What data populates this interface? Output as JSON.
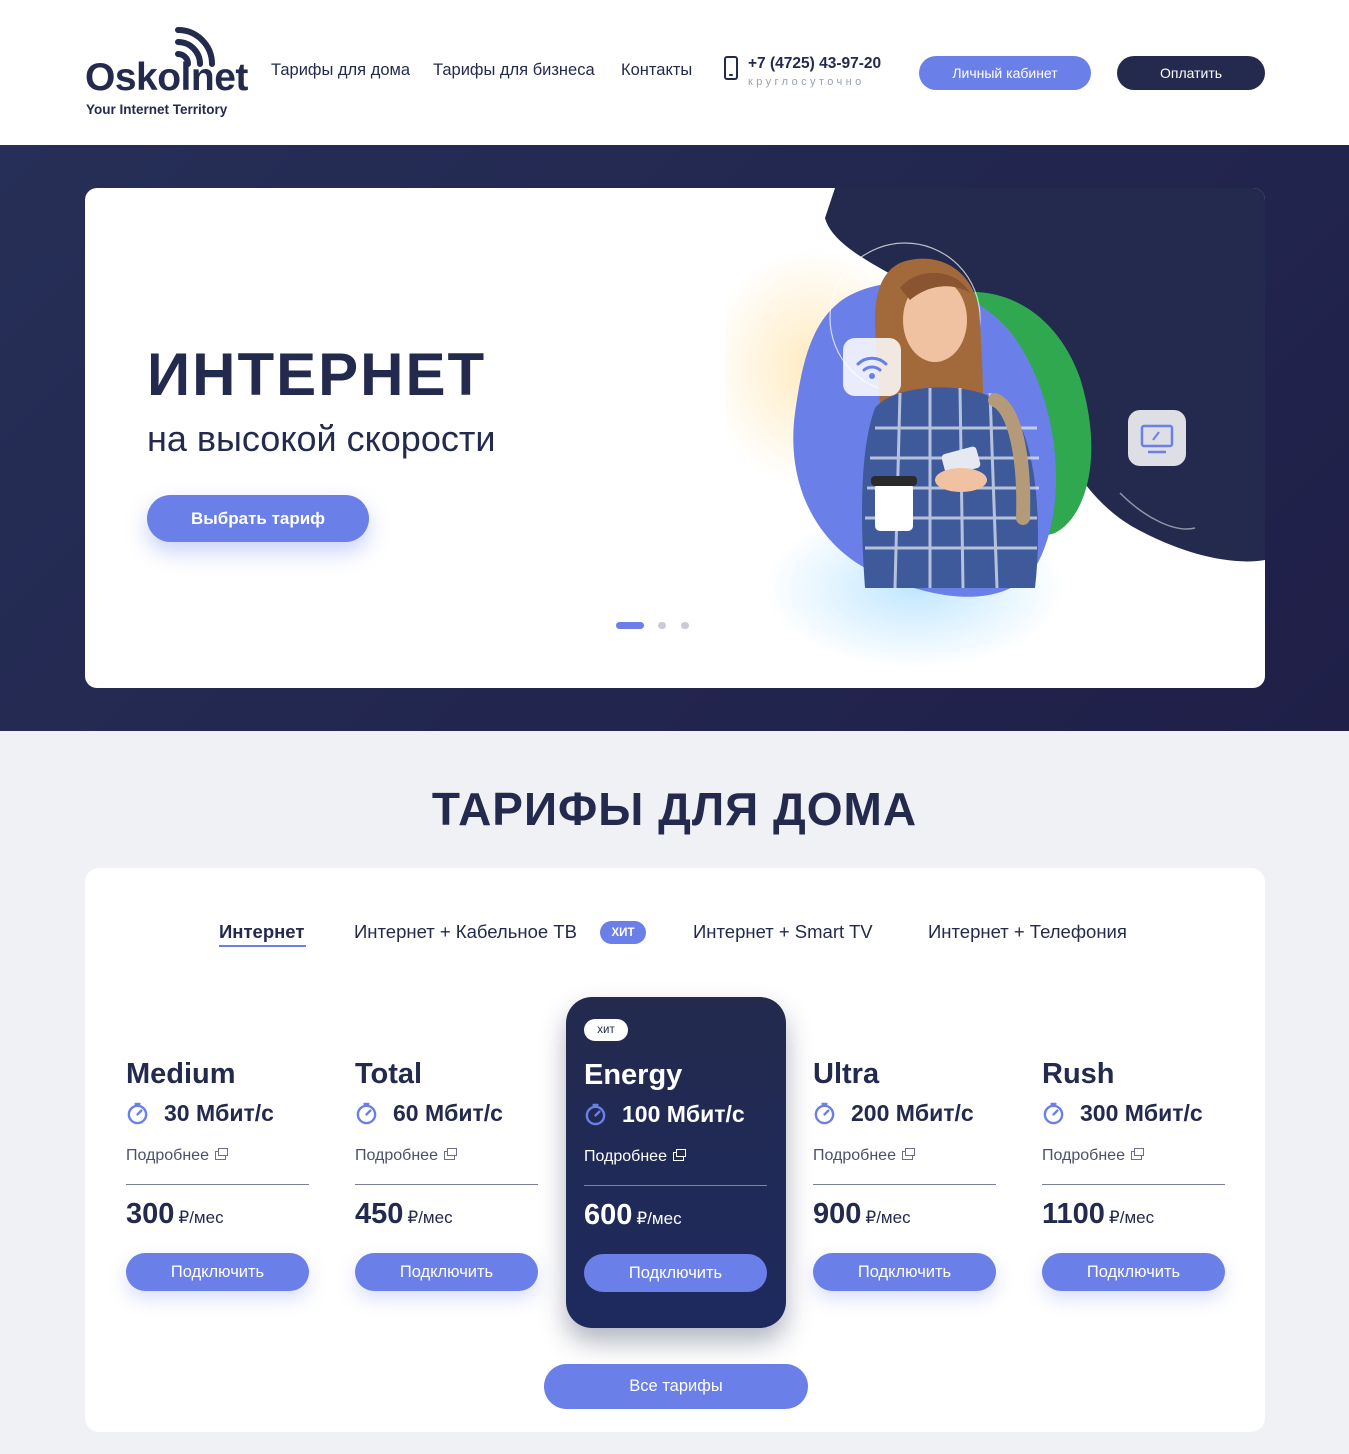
{
  "header": {
    "logo_word": "Oskolnet",
    "logo_tagline": "Your Internet Territory",
    "nav": [
      "Тарифы для дома",
      "Тарифы для бизнеса",
      "Контакты"
    ],
    "phone": "+7 (4725) 43-97-20",
    "phone_note": "круглосуточно",
    "cabinet_label": "Личный кабинет",
    "pay_label": "Оплатить"
  },
  "hero": {
    "title": "ИНТЕРНЕТ",
    "subtitle": "на высокой скорости",
    "cta_label": "Выбрать тариф",
    "slides_total": 3,
    "active_slide": 1
  },
  "tariffs": {
    "title": "ТАРИФЫ ДЛЯ ДОМА",
    "tabs": [
      "Интернет",
      "Интернет + Кабельное ТВ",
      "Интернет + Smart TV",
      "Интернет + Телефония"
    ],
    "active_tab": "Интернет",
    "tab_badge": "ХИТ",
    "hit_label": "хит",
    "more_label": "Подробнее",
    "connect_label": "Подключить",
    "unit_label": "₽/мес",
    "plans": [
      {
        "name": "Medium",
        "speed": "30 Мбит/с",
        "price": "300"
      },
      {
        "name": "Total",
        "speed": "60 Мбит/с",
        "price": "450"
      },
      {
        "name": "Energy",
        "speed": "100 Мбит/с",
        "price": "600",
        "highlighted": true
      },
      {
        "name": "Ultra",
        "speed": "200 Мбит/с",
        "price": "900"
      },
      {
        "name": "Rush",
        "speed": "300 Мбит/с",
        "price": "1100"
      }
    ],
    "all_label": "Все тарифы"
  },
  "colors": {
    "navy": "#232a4e",
    "accent": "#6b7fe8",
    "green": "#2fa84f",
    "page_bg": "#f0f1f4"
  }
}
